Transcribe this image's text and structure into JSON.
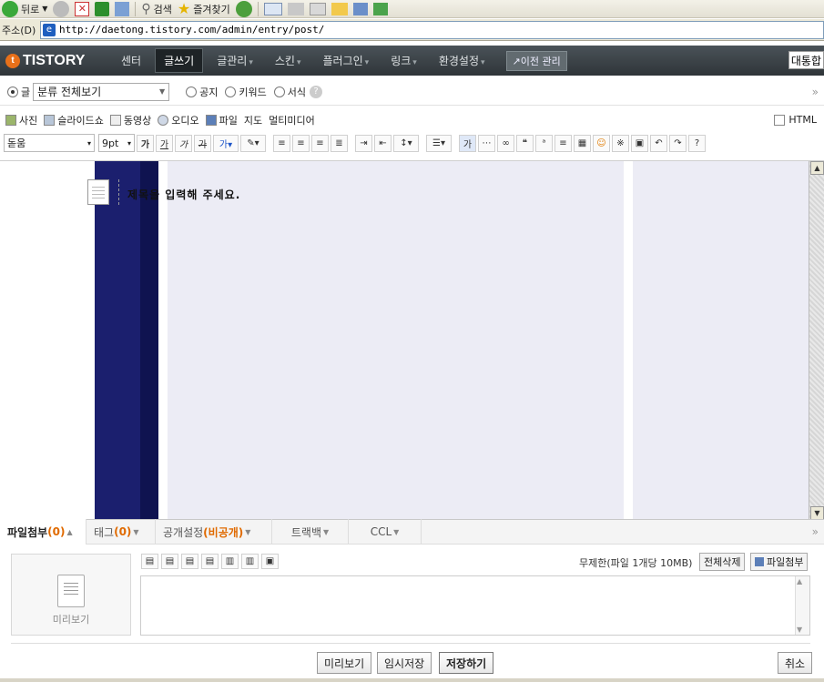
{
  "browser": {
    "toolbar": {
      "back_label": "뒤로",
      "search_label": "검색",
      "favorites_label": "즐겨찾기"
    },
    "address": {
      "label": "주소(D)",
      "url": "http://daetong.tistory.com/admin/entry/post/"
    }
  },
  "nav": {
    "logo": "TISTORY",
    "items": [
      {
        "label": "센터"
      },
      {
        "label": "글쓰기"
      },
      {
        "label": "글관리"
      },
      {
        "label": "스킨"
      },
      {
        "label": "플러그인"
      },
      {
        "label": "링크"
      },
      {
        "label": "환경설정"
      }
    ],
    "prev_admin": "이전 관리",
    "integrated": "대통합"
  },
  "post_type": {
    "post_label": "글",
    "category": "분류 전체보기",
    "notice_label": "공지",
    "keyword_label": "키워드",
    "template_label": "서식",
    "help": "?",
    "expand": "»"
  },
  "attach_toolbar": {
    "items": [
      "사진",
      "슬라이드쇼",
      "동영상",
      "오디오",
      "파일",
      "지도",
      "멀티미디어"
    ],
    "html_label": "HTML"
  },
  "format_toolbar": {
    "font": "돋움",
    "size": "9pt",
    "help": "?"
  },
  "editor": {
    "title_placeholder": "제목을 입력해 주세요."
  },
  "bottom_tabs": {
    "file_attach": "파일첨부",
    "file_count": "(0)",
    "tag": "태그",
    "tag_count": "(0)",
    "publish": "공개설정",
    "publish_status": "(비공개)",
    "trackback": "트랙백",
    "ccl": "CCL"
  },
  "attachment_panel": {
    "preview_label": "미리보기",
    "limit_text": "무제한(파일 1개당 10MB)",
    "delete_all": "전체삭제",
    "attach_file": "파일첨부"
  },
  "actions": {
    "preview": "미리보기",
    "temp_save": "임시저장",
    "save": "저장하기",
    "cancel": "취소"
  }
}
